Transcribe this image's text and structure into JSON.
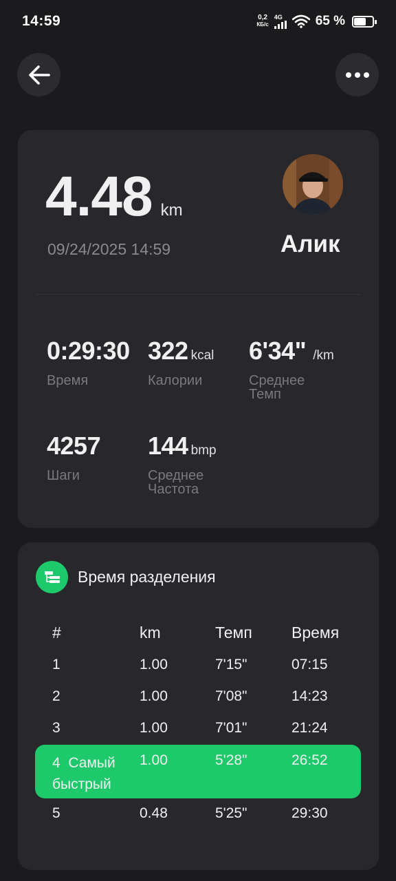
{
  "status_bar": {
    "time": "14:59",
    "net_speed_value": "0,2",
    "net_speed_unit": "КБ/с",
    "network": "4G",
    "battery_percent": "65 %",
    "battery_level": 0.65
  },
  "header": {
    "back_icon": "arrow-left-icon",
    "more_icon": "more-horizontal-icon"
  },
  "summary": {
    "distance": "4.48",
    "distance_unit": "km",
    "datetime": "09/24/2025 14:59",
    "user_name": "Алик"
  },
  "stats": [
    {
      "value": "0:29:30",
      "unit": "",
      "label": "Время"
    },
    {
      "value": "322",
      "unit": "kcal",
      "label": "Калории"
    },
    {
      "value": "6'34\"",
      "unit": "/km",
      "label": "Среднее Темп"
    },
    {
      "value": "4257",
      "unit": "",
      "label": "Шаги"
    },
    {
      "value": "144",
      "unit": "bmp",
      "label": "Среднее Частота"
    }
  ],
  "splits": {
    "title": "Время разделения",
    "columns": [
      "#",
      "km",
      "Темп",
      "Время"
    ],
    "rows": [
      {
        "num": "1",
        "km": "1.00",
        "pace": "7'15\"",
        "time": "07:15"
      },
      {
        "num": "2",
        "km": "1.00",
        "pace": "7'08\"",
        "time": "14:23"
      },
      {
        "num": "3",
        "km": "1.00",
        "pace": "7'01\"",
        "time": "21:24"
      },
      {
        "num": "4",
        "label": "Самый быстрый",
        "km": "1.00",
        "pace": "5'28\"",
        "time": "26:52"
      },
      {
        "num": "5",
        "km": "0.48",
        "pace": "5'25\"",
        "time": "29:30"
      }
    ],
    "highlight_color": "#1ec96c"
  }
}
